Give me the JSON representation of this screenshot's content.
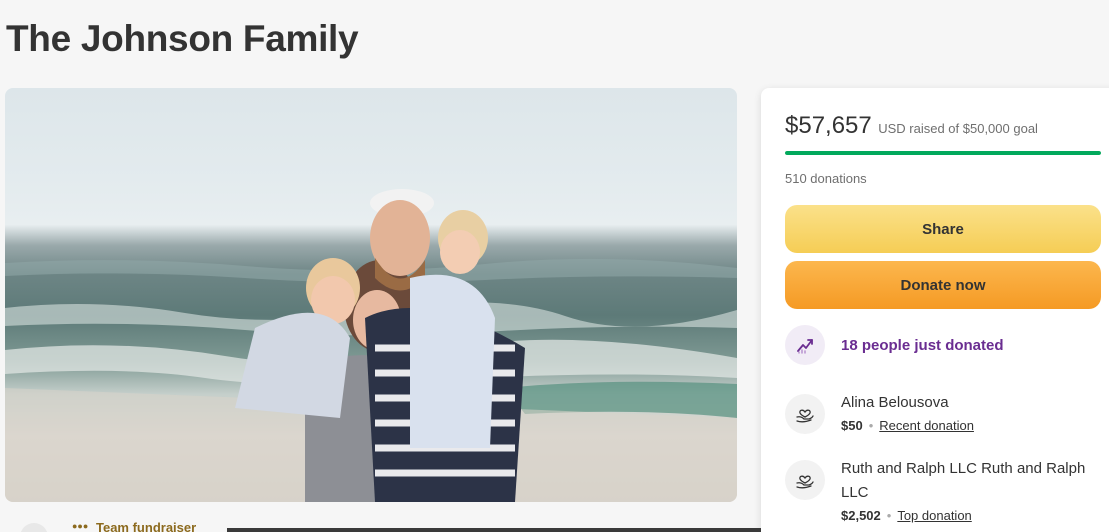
{
  "campaign": {
    "title": "The Johnson Family"
  },
  "fundraiser": {
    "amount_raised": "$57,657",
    "goal_text": "USD raised of $50,000 goal",
    "progress_fraction": 1.0,
    "donations_count": "510 donations",
    "share_label": "Share",
    "donate_label": "Donate now",
    "recent_activity": "18 people just donated",
    "donors": [
      {
        "name": "Alina Belousova",
        "amount": "$50",
        "tag": "Recent donation"
      },
      {
        "name": "Ruth and Ralph LLC Ruth and Ralph LLC",
        "amount": "$2,502",
        "tag": "Top donation"
      }
    ]
  },
  "organizer": {
    "team_label": "Team fundraiser"
  },
  "colors": {
    "progress": "#02a95c",
    "share": "#f7d46b",
    "donate": "#f8a93a",
    "trend": "#6a2d91"
  }
}
